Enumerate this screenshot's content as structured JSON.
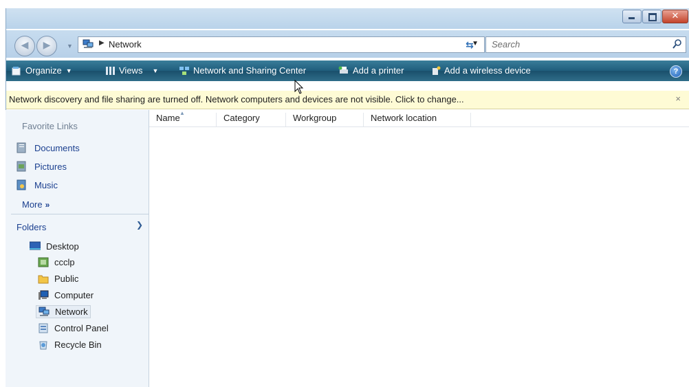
{
  "address": {
    "location": "Network"
  },
  "search": {
    "placeholder": "Search"
  },
  "toolbar": {
    "organize": "Organize",
    "views": "Views",
    "network_sharing_center": "Network and Sharing Center",
    "add_printer": "Add a printer",
    "add_wireless_device": "Add a wireless device",
    "help": "?"
  },
  "infobar": {
    "message": "Network discovery and file sharing are turned off. Network computers and devices are not visible. Click to change...",
    "close": "×"
  },
  "favorite_links": {
    "heading": "Favorite Links",
    "items": [
      {
        "label": "Documents",
        "icon": "documents-icon"
      },
      {
        "label": "Pictures",
        "icon": "pictures-icon"
      },
      {
        "label": "Music",
        "icon": "music-icon"
      }
    ],
    "more": "More"
  },
  "folders": {
    "heading": "Folders",
    "items": [
      {
        "label": "Desktop",
        "icon": "desktop-icon"
      },
      {
        "label": "ccclp",
        "icon": "user-folder-icon"
      },
      {
        "label": "Public",
        "icon": "folder-icon"
      },
      {
        "label": "Computer",
        "icon": "computer-icon"
      },
      {
        "label": "Network",
        "icon": "network-icon",
        "selected": true
      },
      {
        "label": "Control Panel",
        "icon": "control-panel-icon"
      },
      {
        "label": "Recycle Bin",
        "icon": "recycle-bin-icon"
      }
    ]
  },
  "columns": [
    "Name",
    "Category",
    "Workgroup",
    "Network location"
  ],
  "colors": {
    "toolbar": "#1f5d7c",
    "infobar": "#fefbd5",
    "link": "#1a3f8f"
  }
}
